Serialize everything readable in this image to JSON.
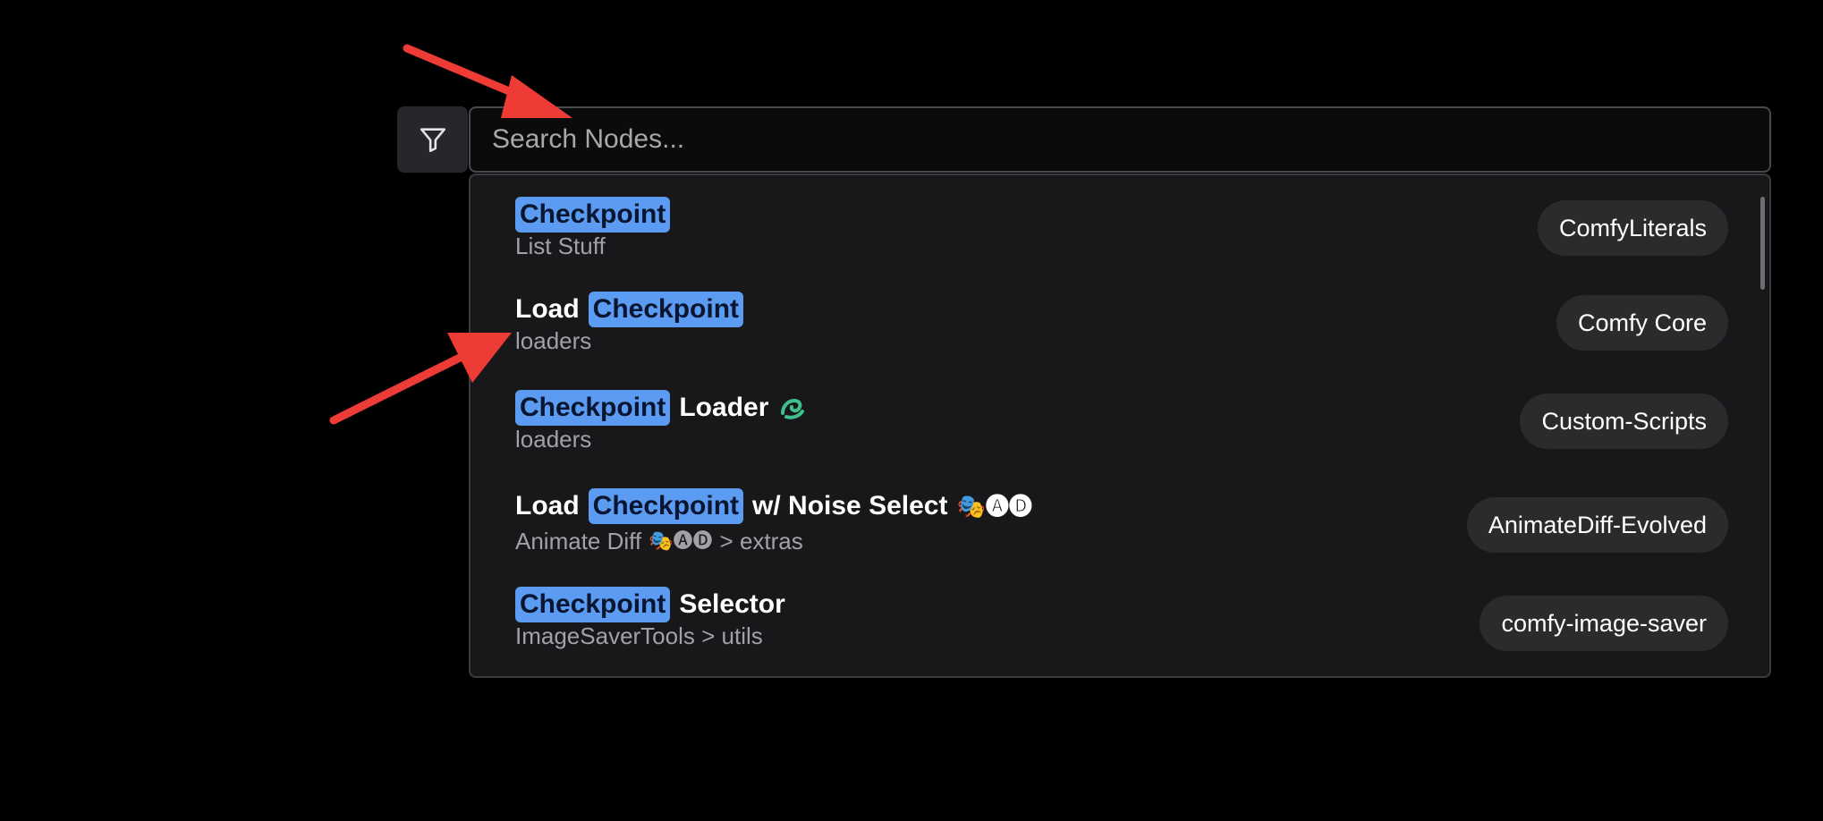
{
  "search": {
    "placeholder": "Search Nodes..."
  },
  "filter": {
    "icon": "filter-icon"
  },
  "results": [
    {
      "title_parts": [
        {
          "text": "Checkpoint",
          "highlight": true
        }
      ],
      "category": "List Stuff",
      "source": "ComfyLiterals"
    },
    {
      "title_parts": [
        {
          "text": "Load",
          "highlight": false
        },
        {
          "text": "Checkpoint",
          "highlight": true
        }
      ],
      "category": "loaders",
      "source": "Comfy Core"
    },
    {
      "title_parts": [
        {
          "text": "Checkpoint",
          "highlight": true
        },
        {
          "text": "Loader",
          "highlight": false
        }
      ],
      "category": "loaders",
      "source": "Custom-Scripts",
      "title_icon": "snake-icon"
    },
    {
      "title_parts": [
        {
          "text": "Load",
          "highlight": false
        },
        {
          "text": "Checkpoint",
          "highlight": true
        },
        {
          "text": "w/ Noise Select",
          "highlight": false
        }
      ],
      "title_suffix": "🎭🅐🅓",
      "category_prefix": "Animate Diff",
      "category_mid": "🎭🅐🅓",
      "category_suffix": "> extras",
      "source": "AnimateDiff-Evolved"
    },
    {
      "title_parts": [
        {
          "text": "Checkpoint",
          "highlight": true
        },
        {
          "text": "Selector",
          "highlight": false
        }
      ],
      "category": "ImageSaverTools > utils",
      "source": "comfy-image-saver"
    }
  ],
  "colors": {
    "highlight": "#5b9cf2",
    "arrow": "#ef3b36",
    "badge_bg": "#2b2b2e",
    "panel_bg": "#18181b"
  }
}
